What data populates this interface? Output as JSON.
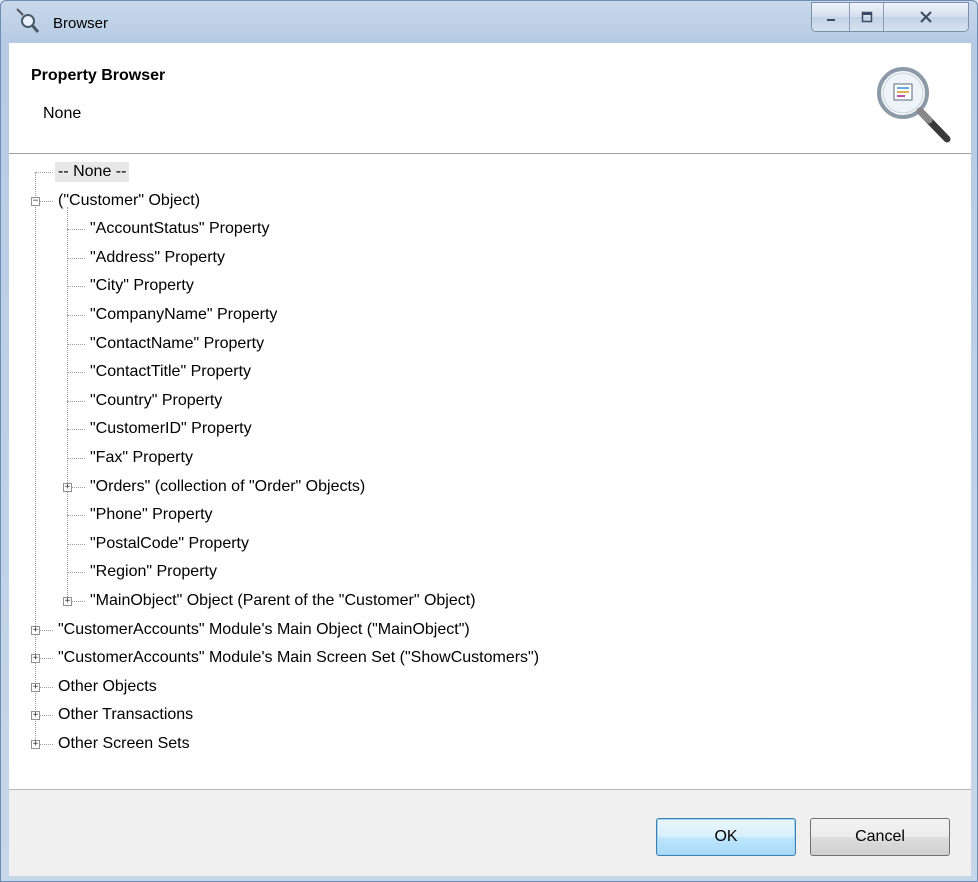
{
  "window": {
    "title": "Browser",
    "icon": "magnifier-icon",
    "controls": {
      "minimize": "minimize-icon",
      "maximize": "maximize-icon",
      "close": "close-icon"
    }
  },
  "header": {
    "title": "Property Browser",
    "subtitle": "None",
    "image": "magnifier-document-icon"
  },
  "tree": {
    "items": [
      {
        "label": "-- None --",
        "level": 0,
        "expander": "none",
        "selected": true
      },
      {
        "label": "(\"Customer\" Object)",
        "level": 0,
        "expander": "expanded"
      },
      {
        "label": "\"AccountStatus\" Property",
        "level": 1,
        "expander": "none"
      },
      {
        "label": "\"Address\" Property",
        "level": 1,
        "expander": "none"
      },
      {
        "label": "\"City\" Property",
        "level": 1,
        "expander": "none"
      },
      {
        "label": "\"CompanyName\" Property",
        "level": 1,
        "expander": "none"
      },
      {
        "label": "\"ContactName\" Property",
        "level": 1,
        "expander": "none"
      },
      {
        "label": "\"ContactTitle\" Property",
        "level": 1,
        "expander": "none"
      },
      {
        "label": "\"Country\" Property",
        "level": 1,
        "expander": "none"
      },
      {
        "label": "\"CustomerID\" Property",
        "level": 1,
        "expander": "none"
      },
      {
        "label": "\"Fax\" Property",
        "level": 1,
        "expander": "none"
      },
      {
        "label": "\"Orders\" (collection of \"Order\" Objects)",
        "level": 1,
        "expander": "collapsed"
      },
      {
        "label": "\"Phone\" Property",
        "level": 1,
        "expander": "none"
      },
      {
        "label": "\"PostalCode\" Property",
        "level": 1,
        "expander": "none"
      },
      {
        "label": "\"Region\" Property",
        "level": 1,
        "expander": "none"
      },
      {
        "label": "\"MainObject\" Object (Parent of the \"Customer\" Object)",
        "level": 1,
        "expander": "collapsed"
      },
      {
        "label": "\"CustomerAccounts\" Module's Main Object (\"MainObject\")",
        "level": 0,
        "expander": "collapsed"
      },
      {
        "label": "\"CustomerAccounts\" Module's Main Screen Set (\"ShowCustomers\")",
        "level": 0,
        "expander": "collapsed"
      },
      {
        "label": "Other Objects",
        "level": 0,
        "expander": "collapsed"
      },
      {
        "label": "Other Transactions",
        "level": 0,
        "expander": "collapsed"
      },
      {
        "label": "Other Screen Sets",
        "level": 0,
        "expander": "collapsed"
      }
    ]
  },
  "buttons": {
    "ok": "OK",
    "cancel": "Cancel"
  }
}
